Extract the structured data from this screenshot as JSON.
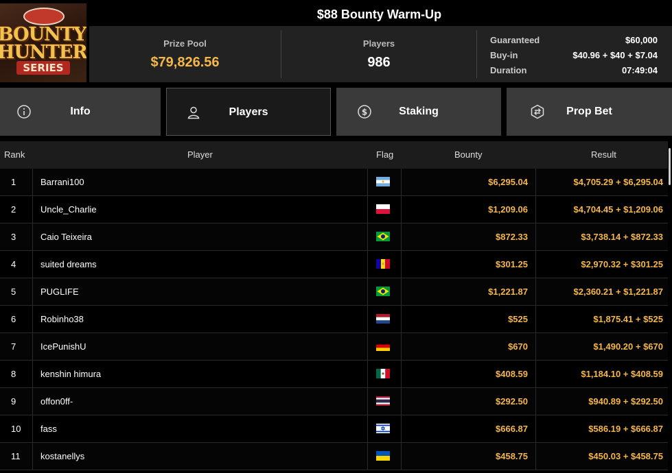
{
  "logo": {
    "line1": "BOUNTY",
    "line2": "HUNTERS",
    "line3": "SERIES"
  },
  "tournament": {
    "title": "$88 Bounty Warm-Up"
  },
  "stats": {
    "prize_pool_label": "Prize Pool",
    "prize_pool_value": "$79,826.56",
    "players_label": "Players",
    "players_value": "986"
  },
  "details": {
    "guaranteed_label": "Guaranteed",
    "guaranteed_value": "$60,000",
    "buyin_label": "Buy-in",
    "buyin_value": "$40.96 + $40 + $7.04",
    "duration_label": "Duration",
    "duration_value": "07:49:04"
  },
  "tabs": [
    {
      "label": "Info",
      "icon": "info-icon"
    },
    {
      "label": "Players",
      "icon": "user-icon"
    },
    {
      "label": "Staking",
      "icon": "dollar-coin-icon"
    },
    {
      "label": "Prop Bet",
      "icon": "prop-bet-icon"
    }
  ],
  "table": {
    "headers": {
      "rank": "Rank",
      "player": "Player",
      "flag": "Flag",
      "bounty": "Bounty",
      "result": "Result"
    },
    "rows": [
      {
        "rank": "1",
        "player": "Barrani100",
        "flag": "argentina",
        "bounty": "$6,295.04",
        "result": "$4,705.29 + $6,295.04"
      },
      {
        "rank": "2",
        "player": "Uncle_Charlie",
        "flag": "poland",
        "bounty": "$1,209.06",
        "result": "$4,704.45 + $1,209.06"
      },
      {
        "rank": "3",
        "player": "Caio Teixeira",
        "flag": "brazil",
        "bounty": "$872.33",
        "result": "$3,738.14 + $872.33"
      },
      {
        "rank": "4",
        "player": "suited dreams",
        "flag": "andorra",
        "bounty": "$301.25",
        "result": "$2,970.32 + $301.25"
      },
      {
        "rank": "5",
        "player": "PUGLIFE",
        "flag": "brazil",
        "bounty": "$1,221.87",
        "result": "$2,360.21 + $1,221.87"
      },
      {
        "rank": "6",
        "player": "Robinho38",
        "flag": "netherlands",
        "bounty": "$525",
        "result": "$1,875.41 + $525"
      },
      {
        "rank": "7",
        "player": "IcePunishU",
        "flag": "germany",
        "bounty": "$670",
        "result": "$1,490.20 + $670"
      },
      {
        "rank": "8",
        "player": "kenshin himura",
        "flag": "mexico",
        "bounty": "$408.59",
        "result": "$1,184.10 + $408.59"
      },
      {
        "rank": "9",
        "player": "offon0ff-",
        "flag": "thailand",
        "bounty": "$292.50",
        "result": "$940.89 + $292.50"
      },
      {
        "rank": "10",
        "player": "fass",
        "flag": "israel",
        "bounty": "$666.87",
        "result": "$586.19 + $666.87"
      },
      {
        "rank": "11",
        "player": "kostanellys",
        "flag": "ukraine",
        "bounty": "$458.75",
        "result": "$450.03 + $458.75"
      }
    ]
  },
  "colors": {
    "accent": "#f5b74a",
    "tab_bg": "#3a3a3a",
    "tab_active_bg": "#1a1a1a"
  }
}
